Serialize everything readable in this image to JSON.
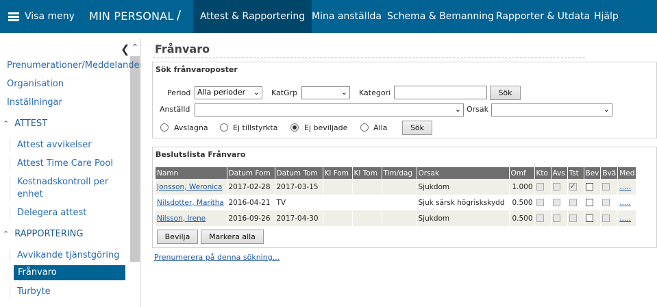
{
  "topbar": {
    "menu_label": "Visa meny",
    "brand": "MIN PERSONAL",
    "separator": "/",
    "tabs": [
      {
        "label": "Attest & Rapportering",
        "active": true
      },
      {
        "label": "Mina anställda"
      },
      {
        "label": "Schema & Bemanning"
      },
      {
        "label": "Rapporter & Utdata"
      },
      {
        "label": "Hjälp"
      }
    ]
  },
  "sidebar": {
    "collapse_icon": "chevron-left-icon",
    "top_items": [
      "Prenumerationer/Meddelanden",
      "Organisation",
      "Inställningar"
    ],
    "sections": [
      {
        "label": "ATTEST",
        "items": [
          "Attest avvikelser",
          "Attest Time Care Pool",
          "Kostnadskontroll per enhet",
          "Delegera attest"
        ]
      },
      {
        "label": "RAPPORTERING",
        "items": [
          "Avvikande tjänstgöring",
          "Frånvaro",
          "Turbyte"
        ]
      }
    ],
    "active_item": "Frånvaro"
  },
  "page": {
    "title": "Frånvaro"
  },
  "search": {
    "title": "Sök frånvaroposter",
    "period_label": "Period",
    "period_value": "Alla perioder",
    "katgrp_label": "KatGrp",
    "katgrp_value": "",
    "kategori_label": "Kategori",
    "kategori_value": "",
    "search_button": "Sök",
    "anstalld_label": "Anställd",
    "anstalld_value": "",
    "orsak_label": "Orsak",
    "orsak_value": "",
    "radios": [
      {
        "label": "Avslagna",
        "checked": false
      },
      {
        "label": "Ej tillstyrkta",
        "checked": false
      },
      {
        "label": "Ej beviljade",
        "checked": true
      },
      {
        "label": "Alla",
        "checked": false
      }
    ],
    "search_button2": "Sök"
  },
  "list": {
    "title": "Beslutslista Frånvaro",
    "columns": [
      "Namn",
      "Datum Fom",
      "Datum Tom",
      "Kl Fom",
      "Kl Tom",
      "Tim/dag",
      "Orsak",
      "Omf",
      "Kto",
      "Avs",
      "Tst",
      "Bev",
      "Bvä",
      "Med"
    ],
    "rows": [
      {
        "namn": "Jonsson, Weronica",
        "datum_fom": "2017-02-28",
        "datum_tom": "2017-03-15",
        "kl_fom": "",
        "kl_tom": "",
        "tim_dag": "",
        "orsak": "Sjukdom",
        "omf": "1.000",
        "tst_checked": true,
        "med": "....."
      },
      {
        "namn": "Nilsdotter, Maritha",
        "datum_fom": "2016-04-21",
        "datum_tom": "TV",
        "kl_fom": "",
        "kl_tom": "",
        "tim_dag": "",
        "orsak": "Sjuk särsk högriskskydd",
        "omf": "0.500",
        "tst_checked": false,
        "med": "....."
      },
      {
        "namn": "Nilsson, Irene",
        "datum_fom": "2016-09-26",
        "datum_tom": "2017-04-30",
        "kl_fom": "",
        "kl_tom": "",
        "tim_dag": "",
        "orsak": "Sjukdom",
        "omf": "0.500",
        "tst_checked": false,
        "med": "....."
      }
    ],
    "approve_button": "Bevilja",
    "select_all_button": "Markera alla"
  },
  "subscribe_link": "Prenumerera på denna sökning..."
}
